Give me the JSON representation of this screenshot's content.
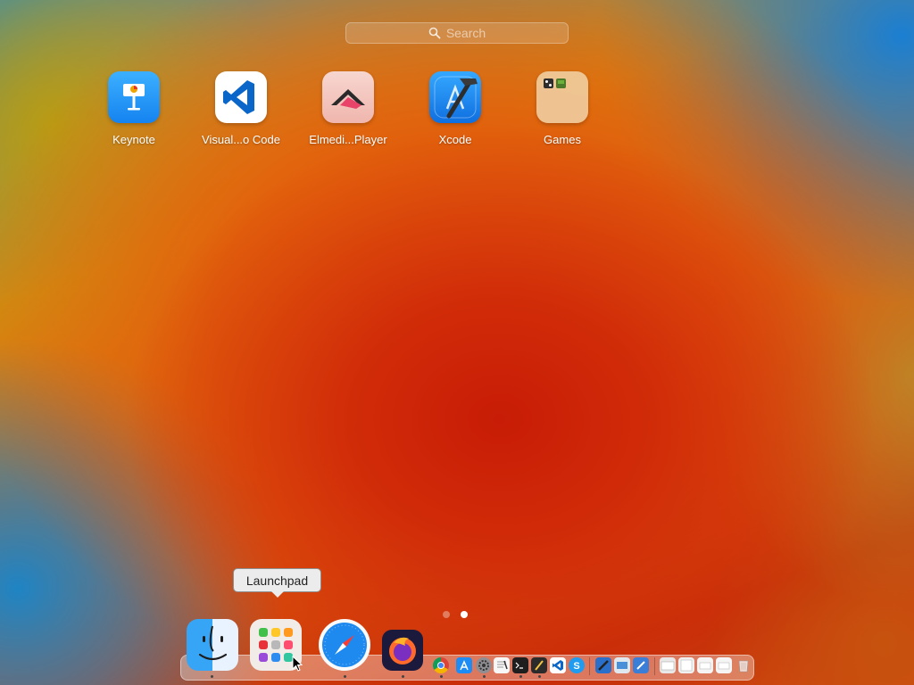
{
  "search": {
    "placeholder": "Search"
  },
  "apps": [
    {
      "label": "Keynote",
      "icon": "keynote-icon"
    },
    {
      "label": "Visual...o Code",
      "icon": "vscode-icon"
    },
    {
      "label": "Elmedi...Player",
      "icon": "elmedia-player-icon"
    },
    {
      "label": "Xcode",
      "icon": "xcode-icon"
    },
    {
      "label": "Games",
      "icon": "games-folder-icon"
    }
  ],
  "pagination": {
    "current_page": 2,
    "total_pages": 2
  },
  "tooltip": {
    "text": "Launchpad"
  },
  "dock": {
    "large_items": [
      "finder-icon",
      "launchpad-icon",
      "safari-icon",
      "firefox-icon"
    ],
    "small_items": [
      "chrome-icon",
      "app-store-icon",
      "system-settings-icon",
      "textedit-icon",
      "terminal-icon",
      "script-editor-icon",
      "vscode-icon",
      "skype-icon",
      "xcode-tool-icon",
      "preview-icon",
      "xcode-instruments-icon",
      "finder-window-icon",
      "screenshot-icon",
      "document-icon",
      "window-icon",
      "trash-icon"
    ]
  },
  "colors": {
    "wallpaper_red": "#c81c06",
    "wallpaper_orange": "#e2560c",
    "wallpaper_blue": "#1b7fd2",
    "keynote_blue": "#1583f0",
    "vscode_blue": "#0a66c8",
    "elmedia_pink": "#e8446a"
  }
}
